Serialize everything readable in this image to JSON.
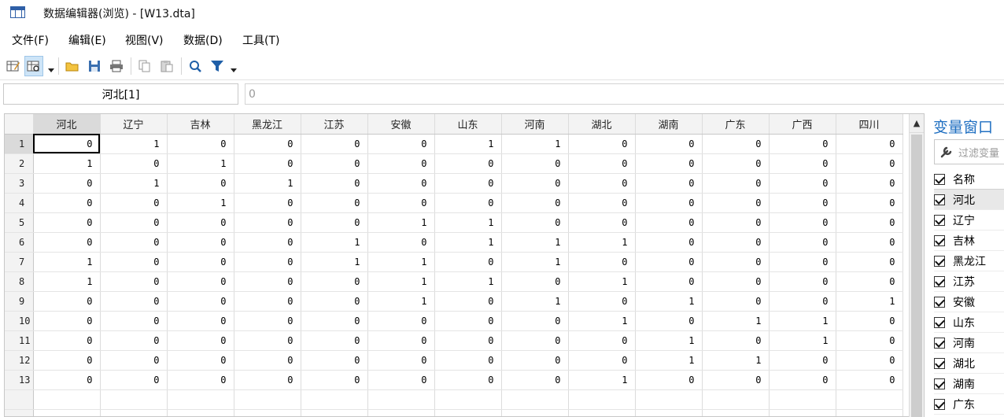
{
  "window": {
    "title": "数据编辑器(浏览) - [W13.dta]"
  },
  "menu": [
    "文件(F)",
    "编辑(E)",
    "视图(V)",
    "数据(D)",
    "工具(T)"
  ],
  "toolbar": {
    "icons": [
      "edit-mode-icon",
      "browse-mode-icon",
      "open-folder-icon",
      "save-icon",
      "print-icon",
      "copy-icon",
      "paste-icon",
      "search-icon",
      "filter-icon"
    ]
  },
  "cell_ref": {
    "name": "河北[1]",
    "value": "0"
  },
  "grid": {
    "columns": [
      "河北",
      "辽宁",
      "吉林",
      "黑龙江",
      "江苏",
      "安徽",
      "山东",
      "河南",
      "湖北",
      "湖南",
      "广东",
      "广西",
      "四川"
    ],
    "rows": [
      {
        "n": "1",
        "v": [
          "0",
          "1",
          "0",
          "0",
          "0",
          "0",
          "1",
          "1",
          "0",
          "0",
          "0",
          "0",
          "0"
        ]
      },
      {
        "n": "2",
        "v": [
          "1",
          "0",
          "1",
          "0",
          "0",
          "0",
          "0",
          "0",
          "0",
          "0",
          "0",
          "0",
          "0"
        ]
      },
      {
        "n": "3",
        "v": [
          "0",
          "1",
          "0",
          "1",
          "0",
          "0",
          "0",
          "0",
          "0",
          "0",
          "0",
          "0",
          "0"
        ]
      },
      {
        "n": "4",
        "v": [
          "0",
          "0",
          "1",
          "0",
          "0",
          "0",
          "0",
          "0",
          "0",
          "0",
          "0",
          "0",
          "0"
        ]
      },
      {
        "n": "5",
        "v": [
          "0",
          "0",
          "0",
          "0",
          "0",
          "1",
          "1",
          "0",
          "0",
          "0",
          "0",
          "0",
          "0"
        ]
      },
      {
        "n": "6",
        "v": [
          "0",
          "0",
          "0",
          "0",
          "1",
          "0",
          "1",
          "1",
          "1",
          "0",
          "0",
          "0",
          "0"
        ]
      },
      {
        "n": "7",
        "v": [
          "1",
          "0",
          "0",
          "0",
          "1",
          "1",
          "0",
          "1",
          "0",
          "0",
          "0",
          "0",
          "0"
        ]
      },
      {
        "n": "8",
        "v": [
          "1",
          "0",
          "0",
          "0",
          "0",
          "1",
          "1",
          "0",
          "1",
          "0",
          "0",
          "0",
          "0"
        ]
      },
      {
        "n": "9",
        "v": [
          "0",
          "0",
          "0",
          "0",
          "0",
          "1",
          "0",
          "1",
          "0",
          "1",
          "0",
          "0",
          "1"
        ]
      },
      {
        "n": "10",
        "v": [
          "0",
          "0",
          "0",
          "0",
          "0",
          "0",
          "0",
          "0",
          "1",
          "0",
          "1",
          "1",
          "0"
        ]
      },
      {
        "n": "11",
        "v": [
          "0",
          "0",
          "0",
          "0",
          "0",
          "0",
          "0",
          "0",
          "0",
          "1",
          "0",
          "1",
          "0"
        ]
      },
      {
        "n": "12",
        "v": [
          "0",
          "0",
          "0",
          "0",
          "0",
          "0",
          "0",
          "0",
          "0",
          "1",
          "1",
          "0",
          "0"
        ]
      },
      {
        "n": "13",
        "v": [
          "0",
          "0",
          "0",
          "0",
          "0",
          "0",
          "0",
          "0",
          "1",
          "0",
          "0",
          "0",
          "0"
        ]
      }
    ]
  },
  "var_panel": {
    "title": "变量窗口",
    "filter_placeholder": "过滤变量",
    "header": "名称",
    "items": [
      "河北",
      "辽宁",
      "吉林",
      "黑龙江",
      "江苏",
      "安徽",
      "山东",
      "河南",
      "湖北",
      "湖南",
      "广东"
    ]
  }
}
